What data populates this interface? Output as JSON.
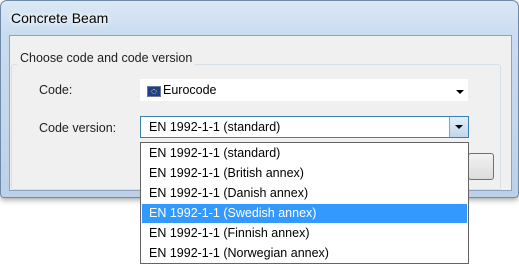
{
  "window": {
    "title": "Concrete Beam"
  },
  "group": {
    "label": "Choose code and code version"
  },
  "code": {
    "label": "Code:",
    "value": "Eurocode",
    "icon": "eu-flag-icon"
  },
  "code_version": {
    "label": "Code version:",
    "value": "EN 1992-1-1 (standard)",
    "options": [
      "EN 1992-1-1 (standard)",
      "EN 1992-1-1 (British annex)",
      "EN 1992-1-1 (Danish annex)",
      "EN 1992-1-1 (Swedish annex)",
      "EN 1992-1-1 (Finnish annex)",
      "EN 1992-1-1 (Norwegian annex)"
    ],
    "highlighted_option": "EN 1992-1-1 (Swedish annex)"
  },
  "colors": {
    "selection": "#3399ff",
    "title_bar": "#c9dcf0"
  }
}
